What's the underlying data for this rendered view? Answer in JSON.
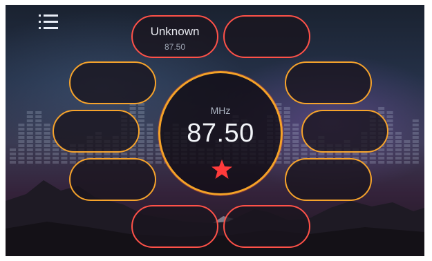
{
  "app": {
    "menu_icon": "list-menu-icon",
    "background": "mountain-night-sky-with-equalizer-bars"
  },
  "tuner": {
    "frequency": "87.50",
    "unit": "MHz",
    "favorite_icon": "star-icon",
    "favorite_color": "#ff3b3b"
  },
  "presets": [
    {
      "name": "Unknown",
      "frequency": "87.50"
    },
    {
      "name": "",
      "frequency": ""
    },
    {
      "name": "",
      "frequency": ""
    },
    {
      "name": "",
      "frequency": ""
    },
    {
      "name": "",
      "frequency": ""
    },
    {
      "name": "",
      "frequency": ""
    },
    {
      "name": "",
      "frequency": ""
    },
    {
      "name": "",
      "frequency": ""
    },
    {
      "name": "",
      "frequency": ""
    },
    {
      "name": "",
      "frequency": ""
    }
  ],
  "colors": {
    "accent_orange": "#f5a227",
    "accent_red": "#ff5148"
  }
}
